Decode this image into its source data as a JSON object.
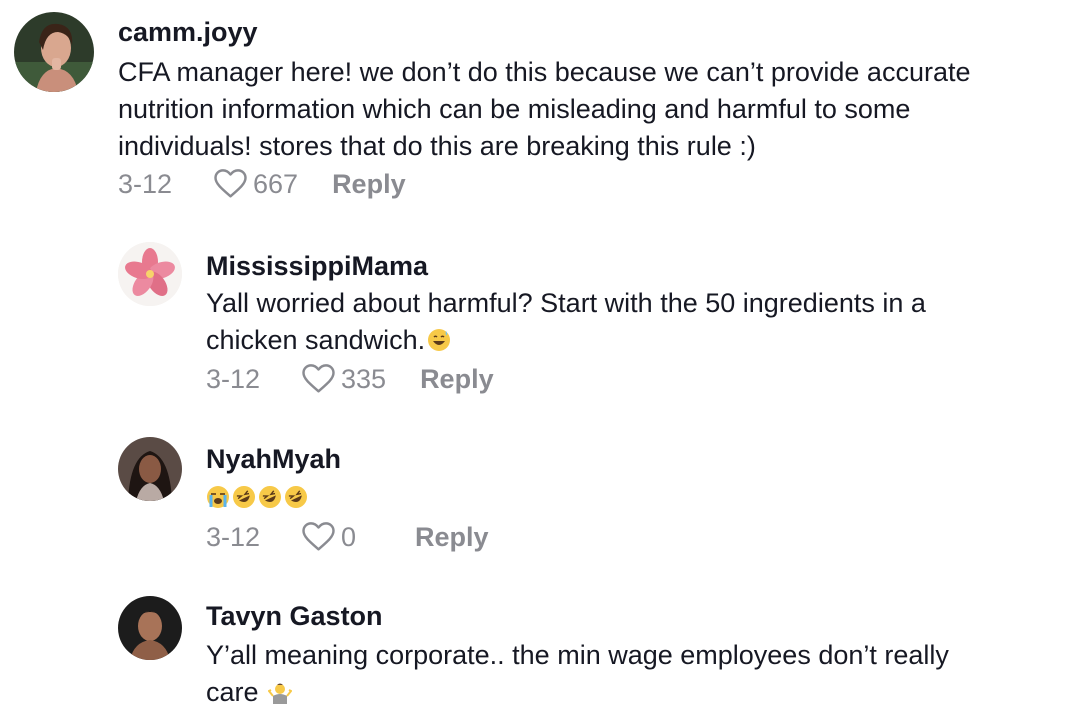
{
  "comments": [
    {
      "username": "camm.joyy",
      "text_lines": [
        "CFA manager here! we don’t do this because we can’t provide accurate",
        "nutrition information which can be misleading and harmful to some",
        "individuals! stores that do this are breaking this rule :)"
      ],
      "date": "3-12",
      "likes": "667",
      "reply_label": "Reply",
      "avatar_icon": "profile-photo"
    },
    {
      "username": "MississippiMama",
      "text_lines": [
        "Yall worried about harmful? Start with the 50 ingredients in a",
        "chicken sandwich."
      ],
      "trailing_emoji": "grinning-sweat-emoji",
      "date": "3-12",
      "likes": "335",
      "reply_label": "Reply",
      "avatar_icon": "plumeria-flower"
    },
    {
      "username": "NyahMyah",
      "emojis": [
        "loudly-crying-emoji",
        "rofl-emoji",
        "rofl-emoji",
        "rofl-emoji"
      ],
      "date": "3-12",
      "likes": "0",
      "reply_label": "Reply",
      "avatar_icon": "profile-photo"
    },
    {
      "username": "Tavyn Gaston",
      "text_lines": [
        "Y’all meaning corporate.. the min wage employees don’t really",
        "care"
      ],
      "trailing_emoji": "person-shrugging-emoji",
      "avatar_icon": "profile-photo"
    }
  ],
  "colors": {
    "primary_text": "#161823",
    "secondary_text": "#8a8b91",
    "background": "#ffffff"
  }
}
